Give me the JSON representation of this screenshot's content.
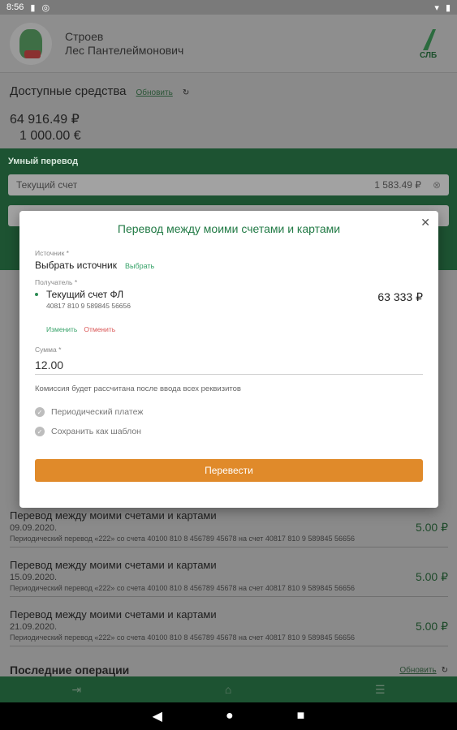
{
  "status": {
    "time": "8:56"
  },
  "header": {
    "name_last": "Строев",
    "name_full": "Лес Пантелеймонович",
    "logo": "СЛБ"
  },
  "funds": {
    "title": "Доступные средства",
    "refresh": "Обновить",
    "amount_rub": "64 916.49 ₽",
    "amount_eur": "1 000.00 €"
  },
  "smart": {
    "title": "Умный перевод",
    "account": "Текущий счет",
    "account_amount": "1 583.49 ₽"
  },
  "dialog": {
    "title": "Перевод между моими счетами и картами",
    "source_label": "Источник *",
    "source_value": "Выбрать источник",
    "source_link": "Выбрать",
    "receiver_label": "Получатель *",
    "receiver_name": "Текущий счет ФЛ",
    "receiver_account": "40817 810 9 589845 56656",
    "receiver_amount": "63 333 ₽",
    "edit": "Изменить",
    "cancel": "Отменить",
    "sum_label": "Сумма *",
    "sum_value": "12.00",
    "fee_note": "Комиссия будет рассчитана после ввода всех реквизитов",
    "periodic": "Периодический платеж",
    "save_template": "Сохранить как шаблон",
    "submit": "Перевести"
  },
  "operations": [
    {
      "title": "Перевод между моими счетами и картами",
      "date": "09.09.2020.",
      "desc": "Периодический перевод «222» со счета 40100 810 8 456789 45678 на счет 40817 810 9 589845 56656",
      "amount": "5.00 ₽"
    },
    {
      "title": "Перевод между моими счетами и картами",
      "date": "15.09.2020.",
      "desc": "Периодический перевод «222» со счета 40100 810 8 456789 45678 на счет 40817 810 9 589845 56656",
      "amount": "5.00 ₽"
    },
    {
      "title": "Перевод между моими счетами и картами",
      "date": "21.09.2020.",
      "desc": "Периодический перевод «222» со счета 40100 810 8 456789 45678 на счет 40817 810 9 589845 56656",
      "amount": "5.00 ₽"
    }
  ],
  "last_ops": {
    "title": "Последние операции",
    "refresh": "Обновить"
  },
  "icons": [
    "close-icon",
    "check-icon",
    "refresh-icon",
    "back-icon",
    "home-icon",
    "recents-icon"
  ],
  "colors": {
    "green": "#217a45",
    "orange": "#e08a2a"
  }
}
